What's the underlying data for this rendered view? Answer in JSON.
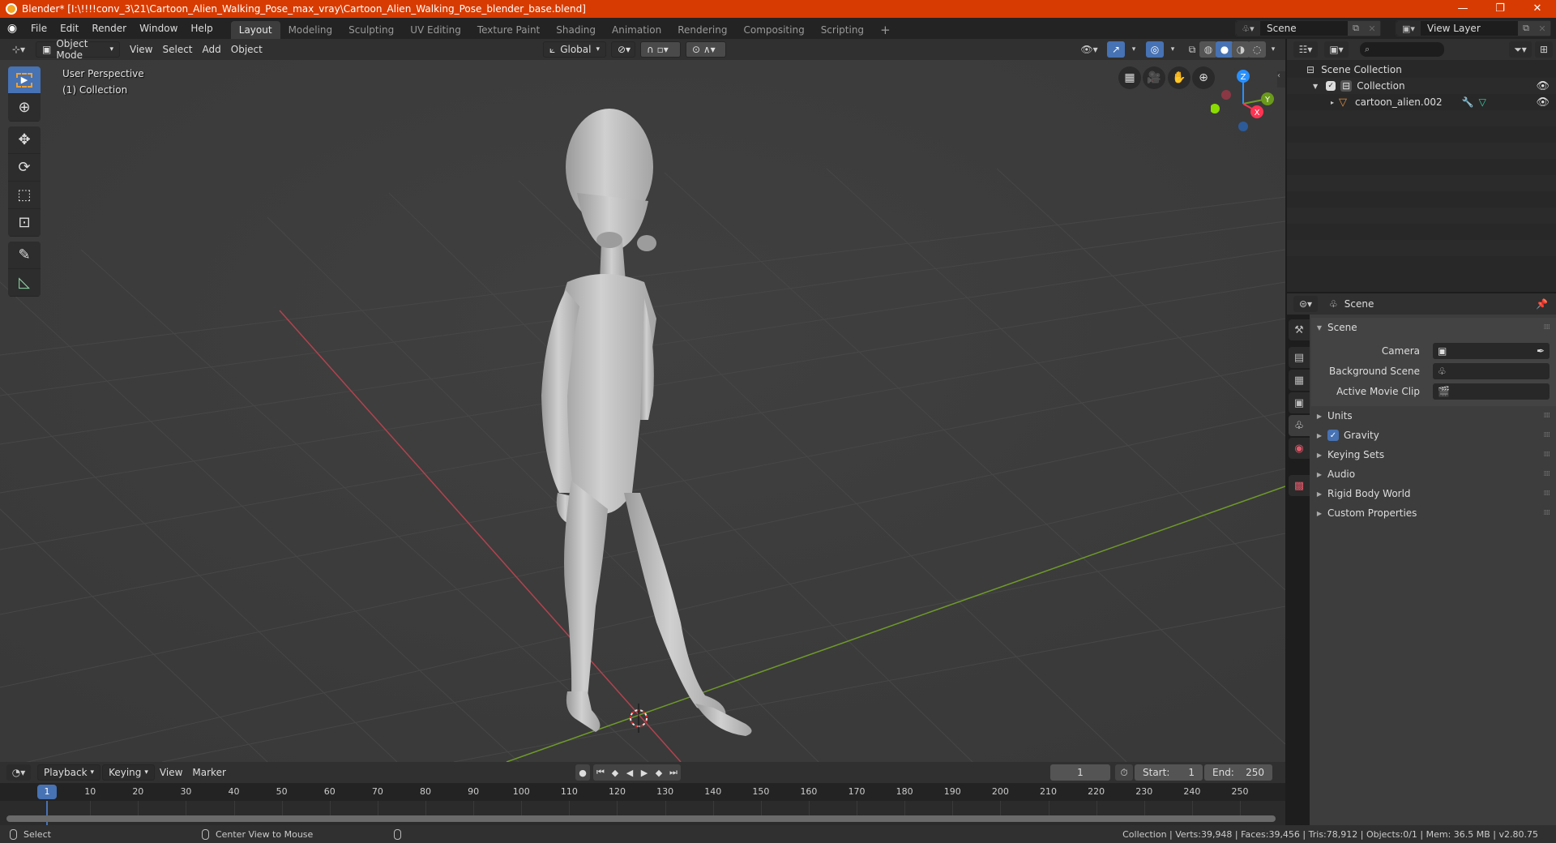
{
  "window": {
    "title": "Blender* [I:\\!!!!conv_3\\21\\Cartoon_Alien_Walking_Pose_max_vray\\Cartoon_Alien_Walking_Pose_blender_base.blend]",
    "minimize": "—",
    "maximize": "❐",
    "close": "✕"
  },
  "topbar": {
    "menus": [
      "File",
      "Edit",
      "Render",
      "Window",
      "Help"
    ],
    "workspaces": [
      "Layout",
      "Modeling",
      "Sculpting",
      "UV Editing",
      "Texture Paint",
      "Shading",
      "Animation",
      "Rendering",
      "Compositing",
      "Scripting"
    ],
    "active_workspace": "Layout",
    "add_workspace": "+",
    "scene_name": "Scene",
    "view_layer_name": "View Layer"
  },
  "viewport": {
    "mode": "Object Mode",
    "menus": [
      "View",
      "Select",
      "Add",
      "Object"
    ],
    "transform_orientation": "Global",
    "overlay_title": "User Perspective",
    "overlay_subtitle": "(1) Collection",
    "gizmo_axes": {
      "x": "X",
      "y": "Y",
      "z": "Z"
    },
    "axis_colors": {
      "x": "#ff3352",
      "y": "#8bdc00",
      "z": "#2890ff"
    },
    "tools": [
      "select-box",
      "cursor",
      "move",
      "rotate",
      "scale",
      "transform",
      "annotate",
      "measure"
    ],
    "active_tool": "select-box",
    "shading_mode": "solid"
  },
  "outliner": {
    "search_placeholder": "",
    "rows": [
      {
        "label": "Scene Collection",
        "type": "scene-collection"
      },
      {
        "label": "Collection",
        "type": "collection",
        "checked": true,
        "visible": true
      },
      {
        "label": "cartoon_alien.002",
        "type": "mesh-object",
        "visible": true
      }
    ]
  },
  "properties": {
    "context": "Scene",
    "panel_title": "Scene",
    "fields": [
      {
        "label": "Camera",
        "value": ""
      },
      {
        "label": "Background Scene",
        "value": ""
      },
      {
        "label": "Active Movie Clip",
        "value": ""
      }
    ],
    "subpanels": [
      {
        "label": "Units"
      },
      {
        "label": "Gravity",
        "checkbox": true
      },
      {
        "label": "Keying Sets"
      },
      {
        "label": "Audio"
      },
      {
        "label": "Rigid Body World"
      },
      {
        "label": "Custom Properties"
      }
    ],
    "active_tab": "scene"
  },
  "timeline": {
    "menus": [
      "Playback",
      "Keying",
      "View",
      "Marker"
    ],
    "current_frame": "1",
    "start_label": "Start:",
    "start": "1",
    "end_label": "End:",
    "end": "250",
    "ruler_ticks": [
      "10",
      "20",
      "30",
      "40",
      "50",
      "60",
      "70",
      "80",
      "90",
      "100",
      "110",
      "120",
      "130",
      "140",
      "150",
      "160",
      "170",
      "180",
      "190",
      "200",
      "210",
      "220",
      "230",
      "240",
      "250"
    ],
    "playhead": "1"
  },
  "statusbar": {
    "left_action": "Select",
    "middle_action": "Center View to Mouse",
    "stats": "Collection | Verts:39,948 | Faces:39,456 | Tris:78,912 | Objects:0/1 | Mem: 36.5 MB | v2.80.75"
  }
}
